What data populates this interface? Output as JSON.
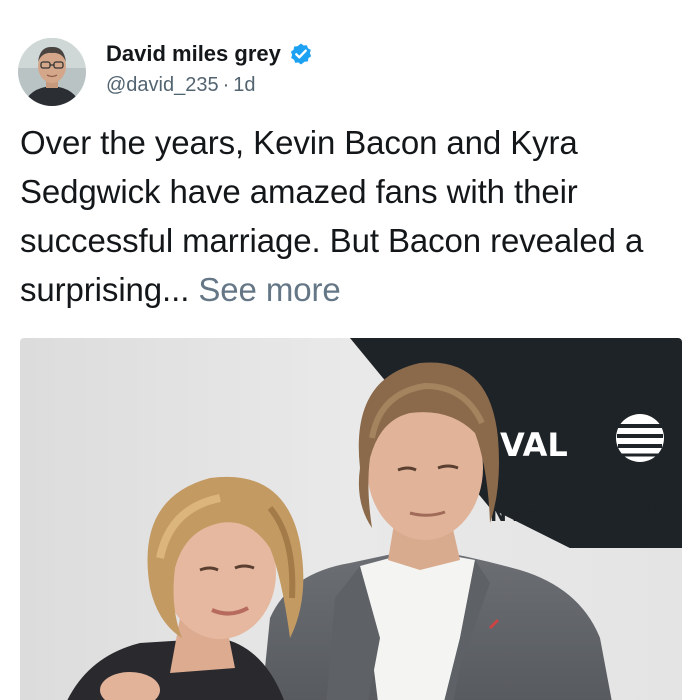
{
  "author": {
    "display_name": "David miles grey",
    "handle": "@david_235",
    "separator": "·",
    "timestamp": "1d",
    "verified_icon": "verified-badge-icon",
    "avatar_icon": "profile-avatar"
  },
  "post": {
    "text": "Over the years, Kevin Bacon and Kyra Sedgwick have amazed fans with their successful marriage. But Bacon revealed a surprising...",
    "see_more": "See more"
  },
  "media": {
    "banner_line1": "VAL",
    "banner_line2": "NTED BY",
    "banner_brand": "AT&",
    "accent_color": "#1da1f2",
    "banner_color": "#1e2327"
  }
}
